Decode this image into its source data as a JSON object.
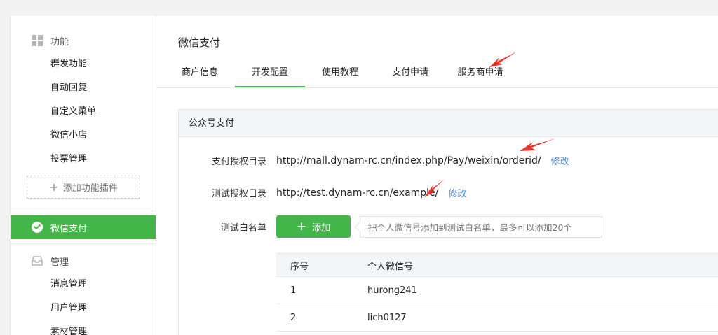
{
  "sidebar": {
    "function_header": "功能",
    "function_items": [
      "群发功能",
      "自动回复",
      "自定义菜单",
      "微信小店",
      "投票管理"
    ],
    "add_plugin_label": "添加功能插件",
    "active_item": "微信支付",
    "manage_header": "管理",
    "manage_items": [
      "消息管理",
      "用户管理",
      "素材管理"
    ]
  },
  "page": {
    "title": "微信支付",
    "tabs": [
      "商户信息",
      "开发配置",
      "使用教程",
      "支付申请",
      "服务商申请"
    ],
    "active_tab": 1
  },
  "panel": {
    "title": "公众号支付",
    "pay_dir_label": "支付授权目录",
    "pay_dir_value": "http://mall.dynam-rc.cn/index.php/Pay/weixin/orderid/",
    "test_dir_label": "测试授权目录",
    "test_dir_value": "http://test.dynam-rc.cn/example/",
    "edit_label": "修改",
    "whitelist_label": "测试白名单",
    "add_button_label": "添加",
    "whitelist_tip": "把个人微信号添加到测试白名单，最多可以添加20个",
    "table": {
      "headers": [
        "序号",
        "个人微信号"
      ],
      "rows": [
        [
          "1",
          "hurong241"
        ],
        [
          "2",
          "lich0127"
        ]
      ]
    }
  },
  "colors": {
    "accent": "#44b549",
    "link": "#4a8bd1",
    "annotation_arrow": "#e8332a"
  }
}
